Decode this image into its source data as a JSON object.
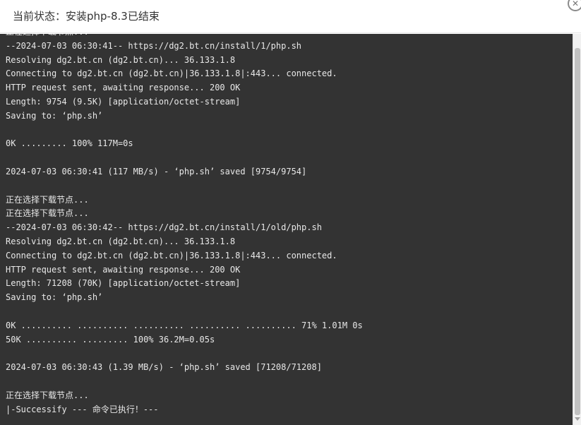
{
  "dialog": {
    "title": "当前状态：安装php-8.3已结束",
    "close_label": "✕"
  },
  "terminal": {
    "lines": [
      "正在选择下载节点...",
      "--2024-07-03 06:30:41-- https://dg2.bt.cn/install/1/php.sh",
      "Resolving dg2.bt.cn (dg2.bt.cn)... 36.133.1.8",
      "Connecting to dg2.bt.cn (dg2.bt.cn)|36.133.1.8|:443... connected.",
      "HTTP request sent, awaiting response... 200 OK",
      "Length: 9754 (9.5K) [application/octet-stream]",
      "Saving to: ‘php.sh’",
      "",
      "0K ......... 100% 117M=0s",
      "",
      "2024-07-03 06:30:41 (117 MB/s) - ‘php.sh’ saved [9754/9754]",
      "",
      "正在选择下载节点...",
      "正在选择下载节点...",
      "--2024-07-03 06:30:42-- https://dg2.bt.cn/install/1/old/php.sh",
      "Resolving dg2.bt.cn (dg2.bt.cn)... 36.133.1.8",
      "Connecting to dg2.bt.cn (dg2.bt.cn)|36.133.1.8|:443... connected.",
      "HTTP request sent, awaiting response... 200 OK",
      "Length: 71208 (70K) [application/octet-stream]",
      "Saving to: ‘php.sh’",
      "",
      "0K .......... .......... .......... .......... .......... 71% 1.01M 0s",
      "50K .......... ......... 100% 36.2M=0.05s",
      "",
      "2024-07-03 06:30:43 (1.39 MB/s) - ‘php.sh’ saved [71208/71208]",
      "",
      "正在选择下载节点...",
      "|-Successify --- 命令已执行！---"
    ]
  }
}
